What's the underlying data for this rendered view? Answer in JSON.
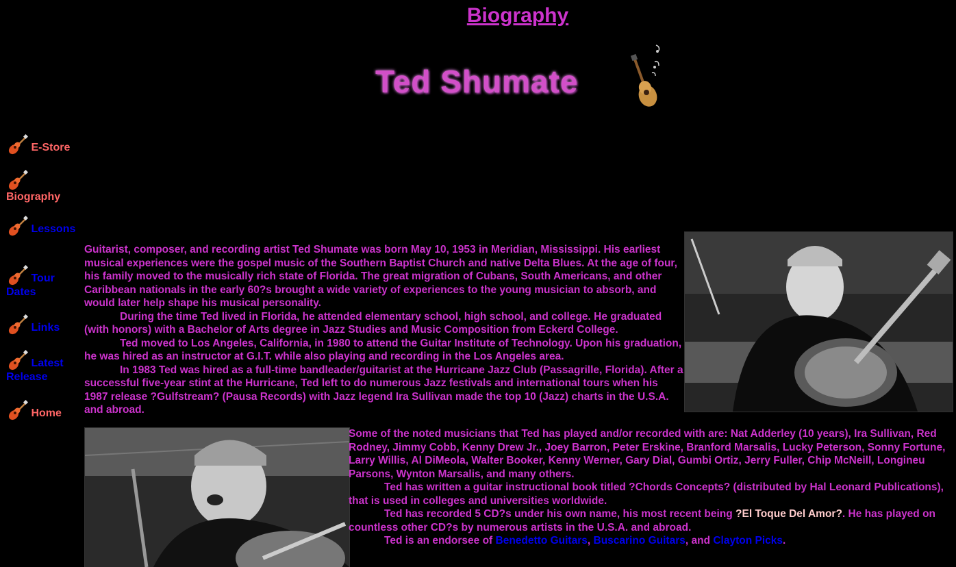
{
  "header": {
    "title": "Biography",
    "logo_text": "Ted Shumate"
  },
  "nav": {
    "items": [
      {
        "label": "E-Store",
        "color": "#ff6666"
      },
      {
        "label": "Biography",
        "color": "#ff6666"
      },
      {
        "label": "Lessons",
        "color": "#0000ee"
      },
      {
        "label_line1": "Tour",
        "label_line2": "Dates",
        "color": "#0000ee"
      },
      {
        "label": "Links",
        "color": "#0000ee"
      },
      {
        "label_line1": "Latest",
        "label_line2": "Release",
        "color": "#0000ee"
      },
      {
        "label": "Home",
        "color": "#ff6666"
      }
    ]
  },
  "bio": {
    "p1": "Guitarist, composer, and recording artist Ted Shumate was born May 10, 1953 in Meridian, Mississippi. His earliest musical experiences were the gospel music of the Southern Baptist Church and native Delta Blues. At the age of four, his family moved to the musically rich state of Florida. The great migration of Cubans, South Americans, and other Caribbean nationals in the early 60?s brought a wide variety of experiences to the young musician to absorb, and would later help shape his musical personality.",
    "p2": "During the time Ted lived in Florida, he attended elementary school, high school, and college. He graduated (with honors) with a Bachelor of Arts degree in Jazz Studies and Music Composition from Eckerd College.",
    "p3": "Ted moved to Los Angeles, California, in 1980 to attend the Guitar Institute of Technology. Upon his graduation, he was hired as an instructor at G.I.T. while also playing and recording in the Los Angeles area.",
    "p4": "In 1983 Ted was hired as a full-time bandleader/guitarist at the Hurricane Jazz Club (Passagrille, Florida). After a successful five-year stint at the Hurricane, Ted left to do numerous Jazz festivals and international tours when his 1987 release ?Gulfstream? (Pausa Records) with Jazz legend Ira Sullivan made the top 10 (Jazz) charts in the U.S.A. and abroad.",
    "p5": "Some of the noted musicians that Ted has played and/or recorded with are: Nat Adderley (10 years), Ira Sullivan, Red Rodney, Jimmy Cobb, Kenny Drew Jr., Joey Barron, Peter Erskine, Branford Marsalis, Lucky Peterson, Sonny Fortune, Larry Willis, Al DiMeola, Walter Booker, Kenny Werner, Gary Dial, Gumbi Ortiz, Jerry Fuller, Chip McNeill, Longineu Parsons, Wynton Marsalis,  and many others.",
    "p6": "Ted has written a guitar instructional book titled ?Chords Concepts? (distributed by Hal Leonard Publications), that is used in colleges and universities worldwide.",
    "p7_a": "Ted has recorded 5 CD?s under his own name, his most recent being ",
    "p7_highlight": "?El Toque Del Amor?",
    "p7_b": ". He has played on countless other CD?s by numerous artists in the U.S.A. and abroad.",
    "p8_a": "Ted is an endorsee of ",
    "endorse_1": "Benedetto Guitars",
    "sep1": ", ",
    "endorse_2": "Buscarino Guitars",
    "sep2": ", and ",
    "endorse_3": "Clayton Picks",
    "p8_end": "."
  },
  "colors": {
    "background": "#000000",
    "text": "#cc33cc",
    "nav_active": "#ff6666",
    "link": "#0000ee",
    "highlight": "#ffcccc"
  }
}
